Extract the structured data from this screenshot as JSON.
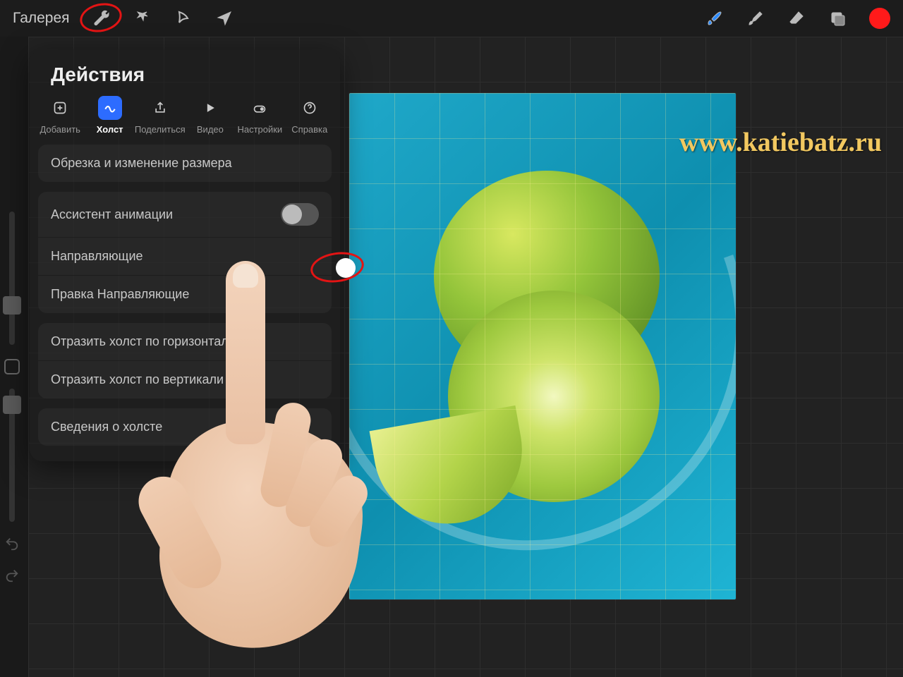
{
  "topbar": {
    "gallery": "Галерея"
  },
  "panel": {
    "title": "Действия",
    "tabs": {
      "add": "Добавить",
      "canvas": "Холст",
      "share": "Поделиться",
      "video": "Видео",
      "settings": "Настройки",
      "help": "Справка"
    },
    "items": {
      "crop": "Обрезка и изменение размера",
      "anim_assist": "Ассистент анимации",
      "guides": "Направляющие",
      "edit_guides": "Правка Направляющие",
      "flip_h": "Отразить холст по горизонтали",
      "flip_v": "Отразить холст по вертикали",
      "canvas_info": "Сведения о холсте"
    },
    "toggles": {
      "anim_assist": false,
      "guides": true
    }
  },
  "watermark": "www.katiebatz.ru",
  "colors": {
    "accent": "#2d6cff",
    "highlight": "#e31414",
    "color_swatch": "#ff1a1a"
  }
}
